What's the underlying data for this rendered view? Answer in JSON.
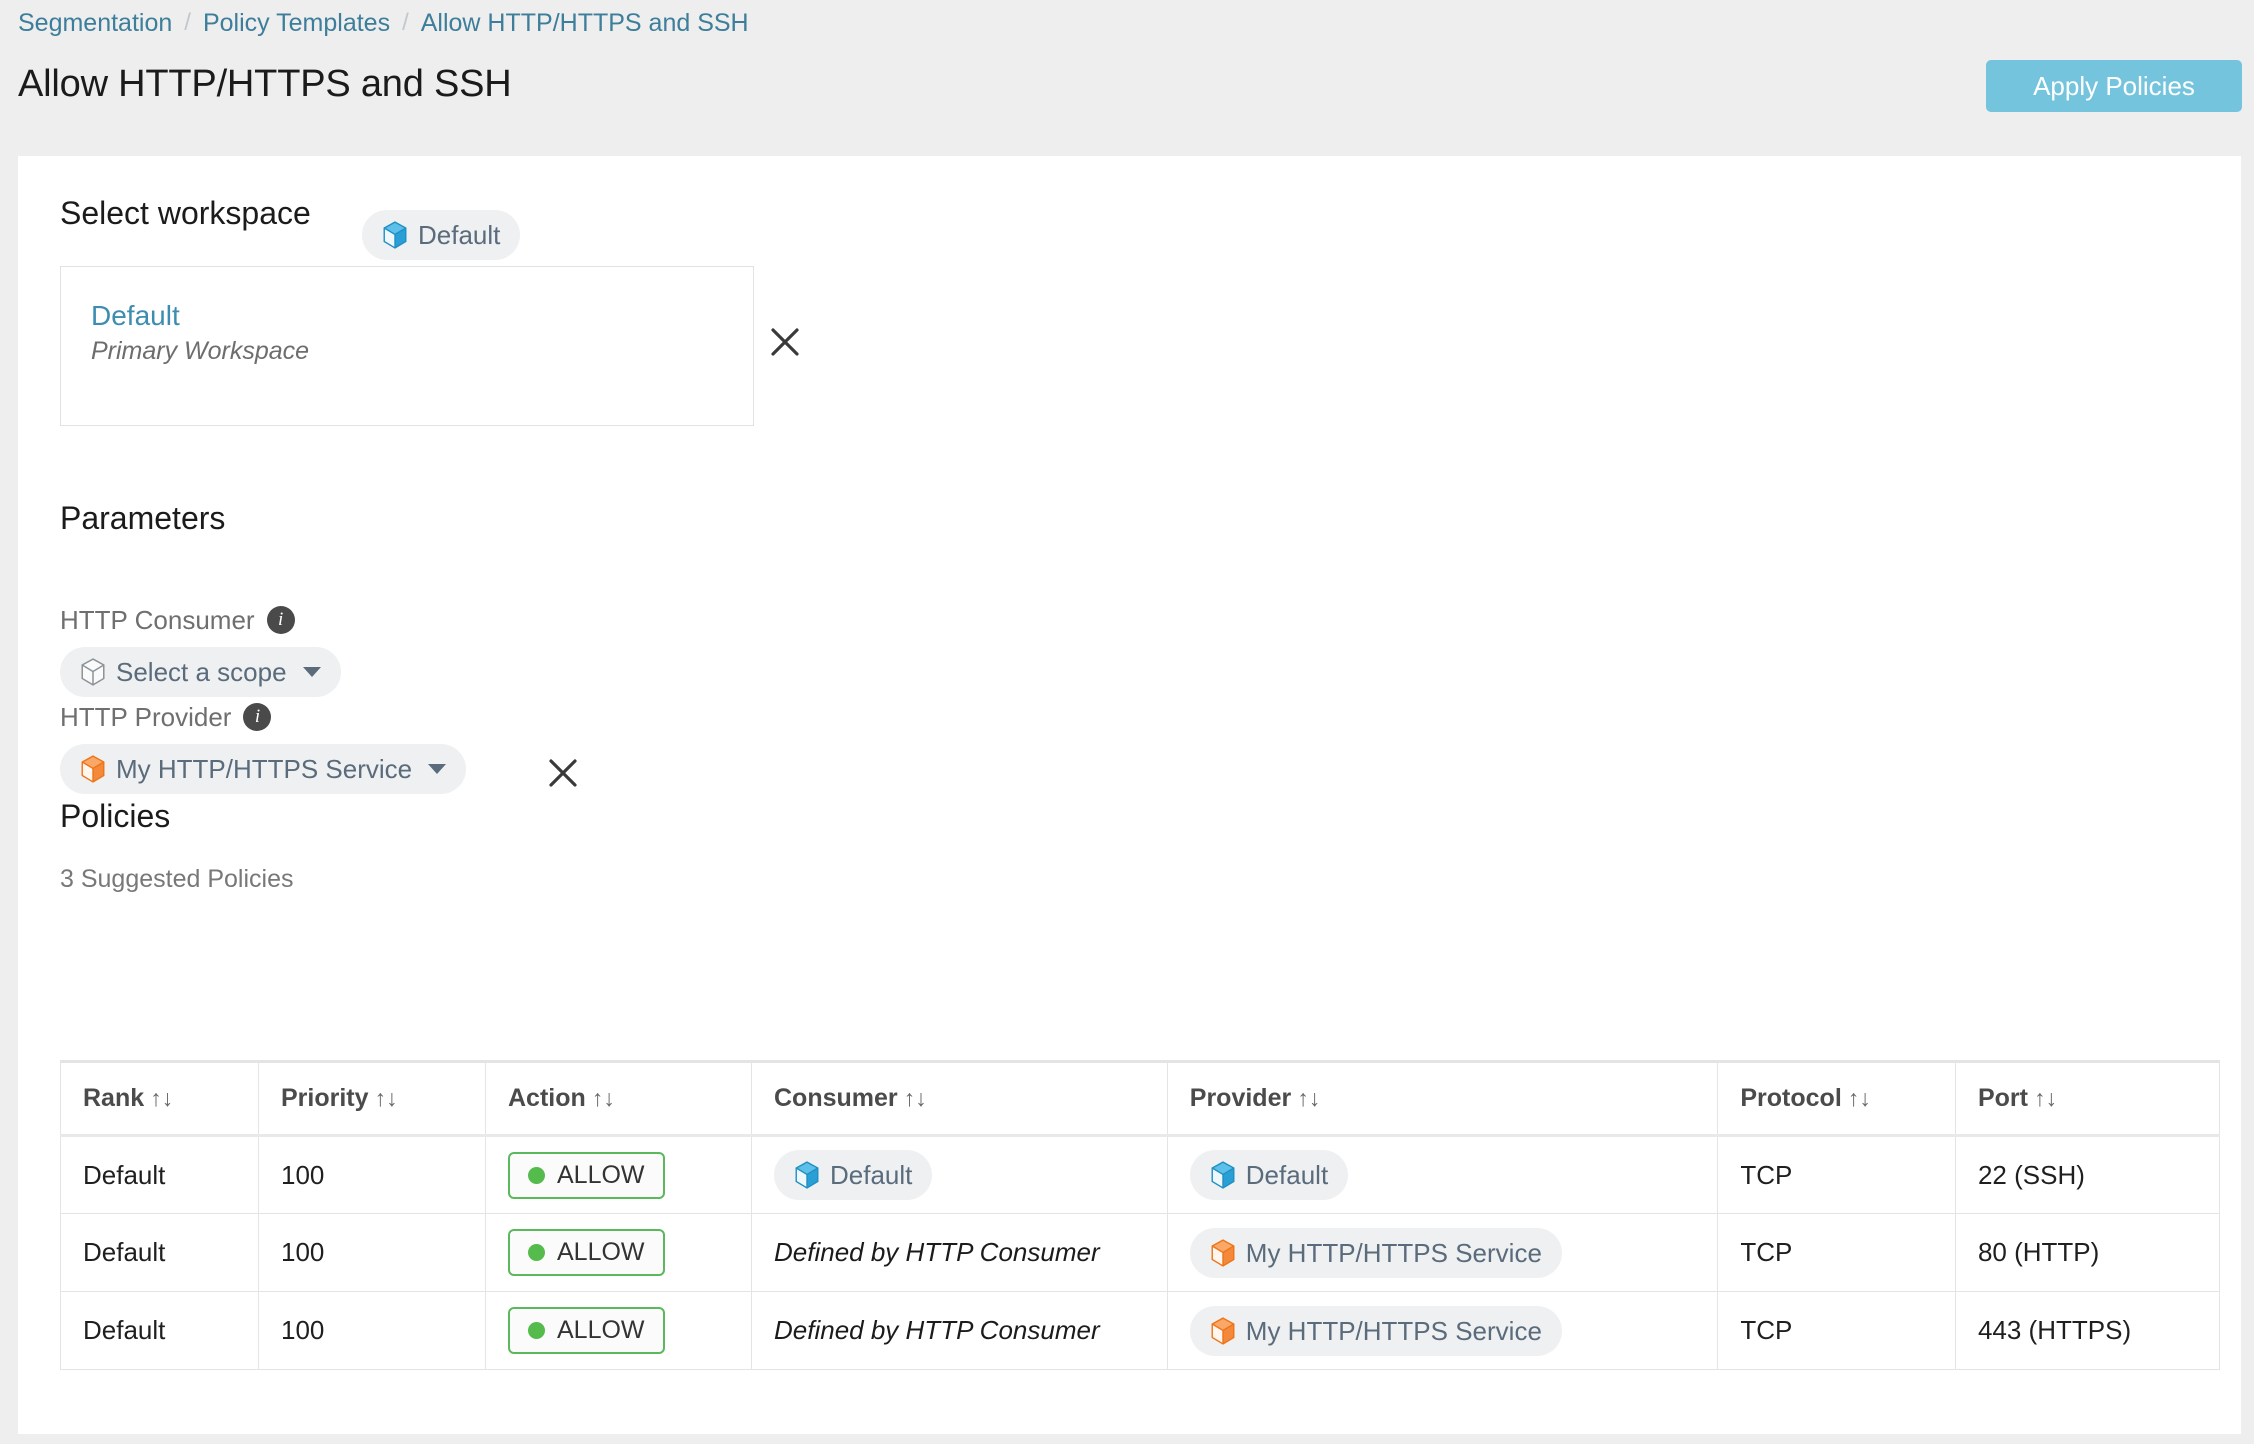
{
  "breadcrumb": {
    "separator": "/",
    "items": [
      {
        "label": "Segmentation"
      },
      {
        "label": "Policy Templates"
      },
      {
        "label": "Allow HTTP/HTTPS and SSH"
      }
    ]
  },
  "header": {
    "title": "Allow HTTP/HTTPS and SSH",
    "apply_label": "Apply Policies",
    "apply_color": "#74c4de"
  },
  "workspace": {
    "heading": "Select workspace",
    "name": "Default",
    "subtitle": "Primary Workspace",
    "chip_label": "Default",
    "chip_icon": "cube-icon-blue",
    "remove_icon": "close-icon"
  },
  "parameters": {
    "heading": "Parameters",
    "fields": [
      {
        "label": "HTTP Consumer",
        "info_icon": "info-icon",
        "value": "Select a scope",
        "icon": "cube-icon-gray",
        "caret": "chevron-down-icon",
        "has_remove": false
      },
      {
        "label": "HTTP Provider",
        "info_icon": "info-icon",
        "value": "My HTTP/HTTPS Service",
        "icon": "cube-icon-orange",
        "caret": "chevron-down-icon",
        "has_remove": true,
        "remove_icon": "close-icon"
      }
    ]
  },
  "policies": {
    "heading": "Policies",
    "count_label": "3 Suggested Policies",
    "sort_glyph": "↑↓",
    "columns": [
      {
        "label": "Rank"
      },
      {
        "label": "Priority"
      },
      {
        "label": "Action"
      },
      {
        "label": "Consumer"
      },
      {
        "label": "Provider"
      },
      {
        "label": "Protocol"
      },
      {
        "label": "Port"
      }
    ],
    "rows": [
      {
        "rank": "Default",
        "priority": "100",
        "action": "ALLOW",
        "consumer_text": "Default",
        "consumer_kind": "chip",
        "consumer_icon": "cube-icon-blue",
        "provider_text": "Default",
        "provider_kind": "chip",
        "provider_icon": "cube-icon-blue",
        "protocol": "TCP",
        "port": "22 (SSH)"
      },
      {
        "rank": "Default",
        "priority": "100",
        "action": "ALLOW",
        "consumer_text": "Defined by HTTP Consumer",
        "consumer_kind": "italic",
        "provider_text": "My HTTP/HTTPS Service",
        "provider_kind": "chip",
        "provider_icon": "cube-icon-orange",
        "protocol": "TCP",
        "port": "80 (HTTP)"
      },
      {
        "rank": "Default",
        "priority": "100",
        "action": "ALLOW",
        "consumer_text": "Defined by HTTP Consumer",
        "consumer_kind": "italic",
        "provider_text": "My HTTP/HTTPS Service",
        "provider_kind": "chip",
        "provider_icon": "cube-icon-orange",
        "protocol": "TCP",
        "port": "443 (HTTPS)"
      }
    ]
  },
  "colors": {
    "link": "#3d7e9a",
    "page_bg": "#eeeeee",
    "chip_bg": "#eff0f1",
    "allow_green": "#5cb85c",
    "cube_blue": "#1f9bd1",
    "cube_orange": "#f07e26",
    "cube_gray": "#8c9499"
  }
}
